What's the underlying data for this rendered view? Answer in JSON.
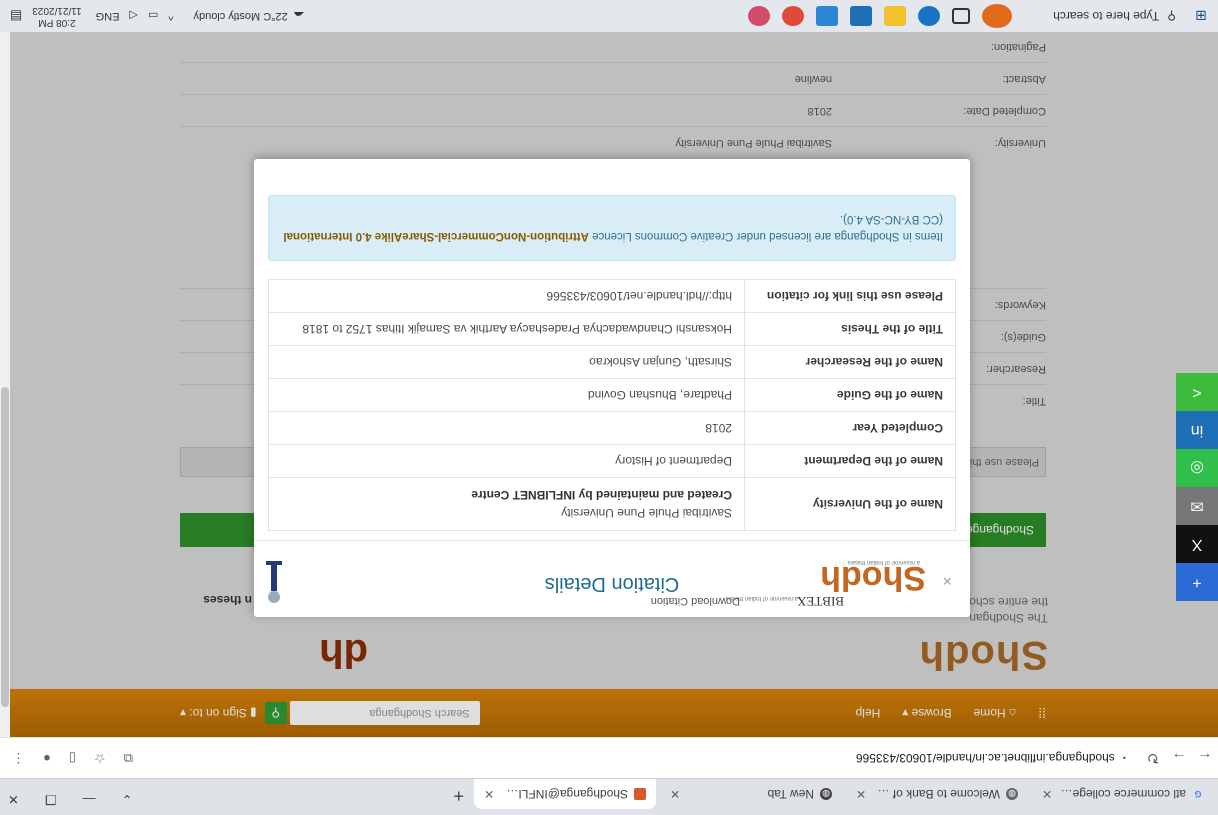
{
  "browser": {
    "tabs": [
      {
        "title": "atl commerce college nurbani",
        "icon": "google-icon",
        "active": false
      },
      {
        "title": "Welcome to Bank of Maharas",
        "icon": "globe-icon",
        "active": false
      },
      {
        "title": "New Tab",
        "icon": "globe-icon",
        "active": false
      },
      {
        "title": "Shodhganga@INFLIBNET: Hol",
        "icon": "shodhganga-icon",
        "active": true
      }
    ],
    "new_tab_label": "+",
    "address": "shodhganga.inflibnet.ac.in/handle/10603/433566"
  },
  "site": {
    "nav": {
      "home": "Home",
      "browse": "Browse",
      "help": "Help",
      "search_placeholder": "Search Shodhganga",
      "sign_on": "Sign on to:"
    },
    "logo_text": "Shodh",
    "logo_right": "dh",
    "logo_sub1": "The Shodhgan",
    "logo_sub2": "the entire scho",
    "logo_right_sub": "n theses",
    "green_bar": "Shodhgange",
    "grey_bar": "Please use thi",
    "meta": [
      {
        "label": "Title:",
        "value": ""
      },
      {
        "label": "Researcher:",
        "value": ""
      },
      {
        "label": "Guide(s):",
        "value": ""
      },
      {
        "label": "Keywords:",
        "value": ""
      },
      {
        "label": "University:",
        "value": "Savitribai Phule Pune University"
      },
      {
        "label": "Completed Date:",
        "value": "2018"
      },
      {
        "label": "Abstract:",
        "value": "newline"
      },
      {
        "label": "Pagination:",
        "value": ""
      }
    ]
  },
  "modal": {
    "title": "Citation Details",
    "close": "×",
    "brand": "Shodh",
    "brand_tag": "a reservoir of Indian theses",
    "download_label": "Download Citation",
    "bibtex": "BIBTEX",
    "bibtex_tag": "a reservoir of Indian theses",
    "rows": [
      {
        "key": "Please use this link for citation",
        "value": "http://hdl.handle.net/10603/433566"
      },
      {
        "key": "Title of the Thesis",
        "value": "Hoksanshi Chandwadachya Pradeshacya Aarthik va Samajik Itihas 1752 to 1818"
      },
      {
        "key": "Name of the Researcher",
        "value": "Shirsath, Gunjan Ashokrao"
      },
      {
        "key": "Name of the Guide",
        "value": "Phadtare, Bhushan Govind"
      },
      {
        "key": "Completed Year",
        "value": "2018"
      },
      {
        "key": "Name of the Department",
        "value": "Department of History"
      },
      {
        "key": "Name of the University",
        "value": "Savitribai Phule Pune University",
        "extra": "Created and maintained by INFLIBNET Centre"
      }
    ],
    "licence_pre": "Items in Shodhganga are licensed under Creative Commons Licence ",
    "licence_link": "Attribution-NonCommercial-ShareAlike 4.0 International",
    "licence_post": " (CC BY-NC-SA 4.0).",
    "licence_colors": {
      "box": "#d9edf7",
      "text": "#31708f"
    }
  },
  "share": [
    {
      "icon": "plus-share-icon",
      "color": "#2a6bd6",
      "glyph": "+"
    },
    {
      "icon": "x-twitter-icon",
      "color": "#111111",
      "glyph": "X"
    },
    {
      "icon": "email-icon",
      "color": "#777777",
      "glyph": "✉"
    },
    {
      "icon": "whatsapp-icon",
      "color": "#2fbf4a",
      "glyph": "◎"
    },
    {
      "icon": "linkedin-icon",
      "color": "#1e6fb5",
      "glyph": "in"
    },
    {
      "icon": "share-icon",
      "color": "#3dbb3d",
      "glyph": "<"
    }
  ],
  "taskbar": {
    "search_placeholder": "Type here to search",
    "weather": "22°C  Mostly cloudy",
    "lang": "ENG",
    "time": "2:08 PM",
    "date": "11/21/2023"
  }
}
